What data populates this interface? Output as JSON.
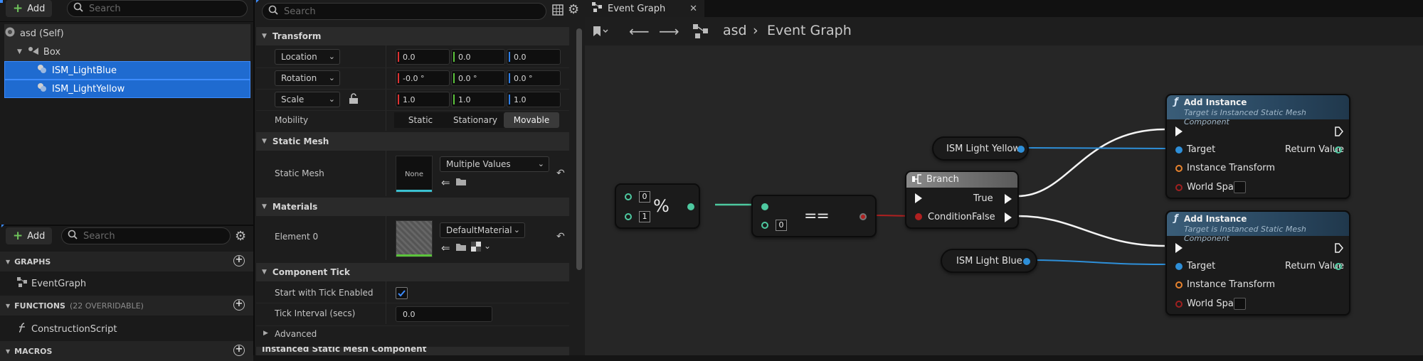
{
  "components": {
    "add_label": "Add",
    "search_placeholder": "Search",
    "tree": [
      {
        "label": "asd (Self)",
        "selected": false
      },
      {
        "label": "Box",
        "selected": false
      },
      {
        "label": "ISM_LightBlue",
        "selected": true
      },
      {
        "label": "ISM_LightYellow",
        "selected": true
      }
    ]
  },
  "my_blueprint": {
    "add_label": "Add",
    "search_placeholder": "Search",
    "sections": {
      "graphs": "GRAPHS",
      "functions": "FUNCTIONS",
      "functions_sub": "(22 OVERRIDABLE)",
      "macros": "MACROS"
    },
    "event_graph": "EventGraph",
    "construction_script": "ConstructionScript"
  },
  "details": {
    "search_placeholder": "Search",
    "transform": {
      "header": "Transform",
      "location_label": "Location",
      "location": [
        "0.0",
        "0.0",
        "0.0"
      ],
      "rotation_label": "Rotation",
      "rotation": [
        "-0.0 °",
        "0.0 °",
        "0.0 °"
      ],
      "scale_label": "Scale",
      "scale": [
        "1.0",
        "1.0",
        "1.0"
      ],
      "mobility_label": "Mobility",
      "mobility_options": [
        "Static",
        "Stationary",
        "Movable"
      ],
      "mobility_selected": "Movable"
    },
    "static_mesh": {
      "header": "Static Mesh",
      "label": "Static Mesh",
      "thumb_text": "None",
      "value": "Multiple Values"
    },
    "materials": {
      "header": "Materials",
      "label": "Element 0",
      "value": "DefaultMaterial"
    },
    "component_tick": {
      "header": "Component Tick",
      "start_label": "Start with Tick Enabled",
      "interval_label": "Tick Interval (secs)",
      "interval_value": "0.0",
      "advanced": "Advanced"
    },
    "next_header": "Instanced Static Mesh Component"
  },
  "graph": {
    "tab_label": "Event Graph",
    "breadcrumb_root": "asd",
    "breadcrumb_current": "Event Graph",
    "nodes": {
      "modulo": {
        "a": "0",
        "b": "1",
        "symbol": "%"
      },
      "equal": {
        "b": "0",
        "symbol": "=="
      },
      "branch": {
        "title": "Branch",
        "condition": "Condition",
        "true": "True",
        "false": "False"
      },
      "ism_yellow": "ISM Light Yellow",
      "ism_blue": "ISM Light Blue",
      "add_instance_1": {
        "title": "Add Instance",
        "subtitle": "Target is Instanced Static Mesh Component",
        "target": "Target",
        "return": "Return Value",
        "transform": "Instance Transform",
        "world": "World Space"
      },
      "add_instance_2": {
        "title": "Add Instance",
        "subtitle": "Target is Instanced Static Mesh Component",
        "target": "Target",
        "return": "Return Value",
        "transform": "Instance Transform",
        "world": "World Space"
      }
    }
  }
}
